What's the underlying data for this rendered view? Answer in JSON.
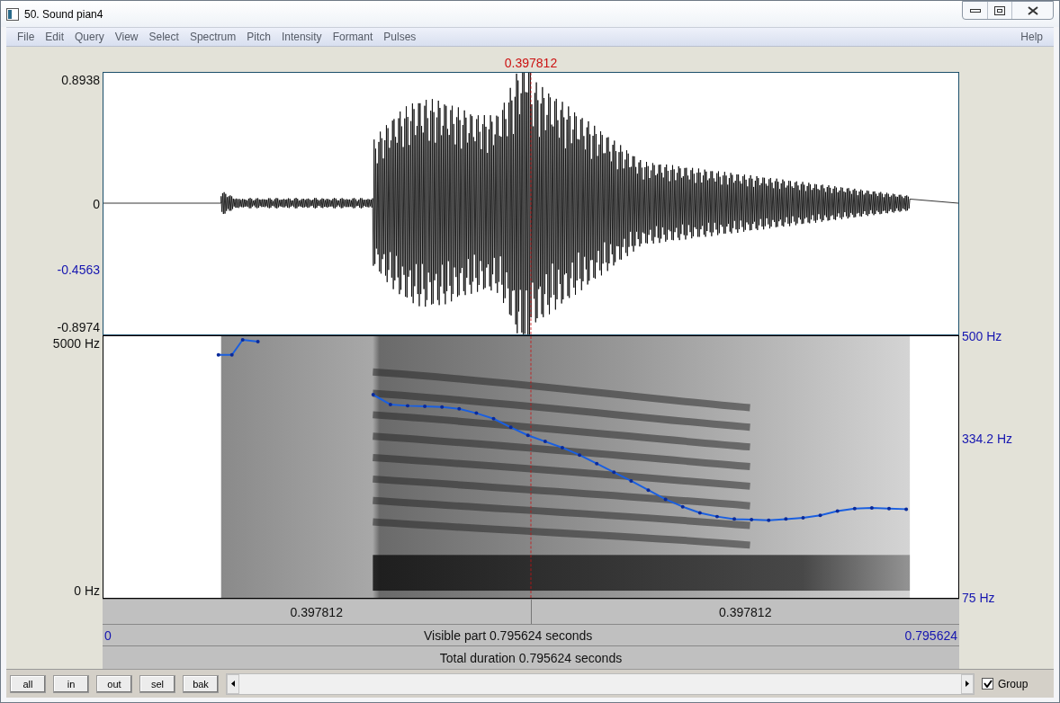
{
  "window": {
    "title": "50. Sound pian4"
  },
  "menu": [
    {
      "label": "File"
    },
    {
      "label": "Edit"
    },
    {
      "label": "Query"
    },
    {
      "label": "View"
    },
    {
      "label": "Select"
    },
    {
      "label": "Spectrum"
    },
    {
      "label": "Pitch"
    },
    {
      "label": "Intensity"
    },
    {
      "label": "Formant"
    },
    {
      "label": "Pulses"
    }
  ],
  "help": "Help",
  "cursor_time": "0.397812",
  "waveform_axis": [
    {
      "label": "0.8938",
      "kind": "limit"
    },
    {
      "label": "0",
      "kind": "zero"
    },
    {
      "label": "-0.4563",
      "kind": "cursor"
    },
    {
      "label": "-0.8974",
      "kind": "limit"
    }
  ],
  "spectrogram_axis": [
    {
      "label": "5000 Hz"
    },
    {
      "label": "0 Hz"
    }
  ],
  "pitch_chart": {
    "chart_data": {
      "type": "line",
      "ylim": [
        75,
        500
      ],
      "yticks": [
        {
          "value": 500,
          "label": "500 Hz"
        },
        {
          "value": 334.2,
          "label": "334.2 Hz"
        },
        {
          "value": 75,
          "label": "75 Hz"
        }
      ],
      "categories": [
        null,
        null,
        null,
        null,
        null,
        null,
        null,
        null,
        null,
        null,
        null,
        null,
        null,
        null,
        null,
        null,
        null,
        null,
        null,
        null,
        null,
        null,
        null,
        null,
        null,
        null,
        null,
        null,
        null,
        null,
        null,
        null
      ],
      "series": [
        {
          "color": "#1a5fe0",
          "values": [
            405,
            389,
            387,
            386,
            385,
            382,
            375,
            366,
            352,
            339,
            329,
            319,
            307,
            293,
            279,
            265,
            250,
            235,
            223,
            213,
            207,
            203,
            202,
            201,
            203,
            205,
            209,
            216,
            220,
            221,
            220,
            219
          ]
        }
      ]
    }
  },
  "cursor_row": [
    "0.397812",
    "0.397812"
  ],
  "visible_row": {
    "start": "0",
    "text": "Visible part 0.795624 seconds",
    "end": "0.795624"
  },
  "total_row": "Total duration 0.795624 seconds",
  "buttons": [
    {
      "label": "all"
    },
    {
      "label": "in"
    },
    {
      "label": "out"
    },
    {
      "label": "sel"
    },
    {
      "label": "bak"
    }
  ],
  "group": {
    "label": "Group",
    "checked": true
  }
}
